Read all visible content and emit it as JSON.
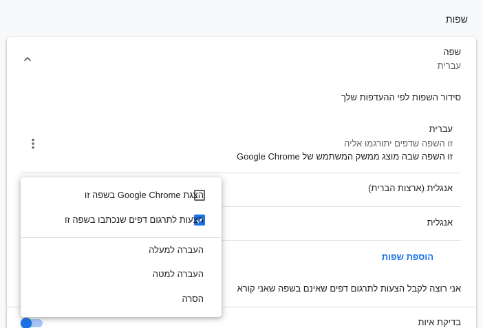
{
  "page": {
    "section_title": "שפות"
  },
  "languages_card": {
    "header_title": "שפה",
    "header_value": "עברית",
    "order_title": "סידור השפות לפי ההעדפות שלך",
    "items": [
      {
        "name": "עברית",
        "desc1": "זו השפה שדפים יתורגמו אליה",
        "desc2": "זו השפה שבה מוצג ממשק המשתמש של Google Chrome"
      },
      {
        "name": "אנגלית (ארצות הברית)"
      },
      {
        "name": "אנגלית"
      }
    ],
    "add_languages": "הוספת שפות",
    "translate_suggest": "אני רוצה לקבל הצעות לתרגום דפים שאינם בשפה שאני קורא",
    "spell_check": "בדיקת איות",
    "spell_check_enabled": true
  },
  "context_menu": {
    "display_chrome": {
      "label": "הצגת Google Chrome בשפה זו",
      "checked": false
    },
    "offer_translate": {
      "label": "הצעות לתרגום דפים שנכתבו בשפה זו",
      "checked": true
    },
    "move_up": "העברה למעלה",
    "move_down": "העברה למטה",
    "remove": "הסרה"
  },
  "colors": {
    "accent": "#1a73e8",
    "text": "#202124",
    "secondary": "#5f6368"
  },
  "icons": {
    "collapse": "chevron-up-icon",
    "more": "more-vert-icon",
    "check": "check-icon"
  }
}
